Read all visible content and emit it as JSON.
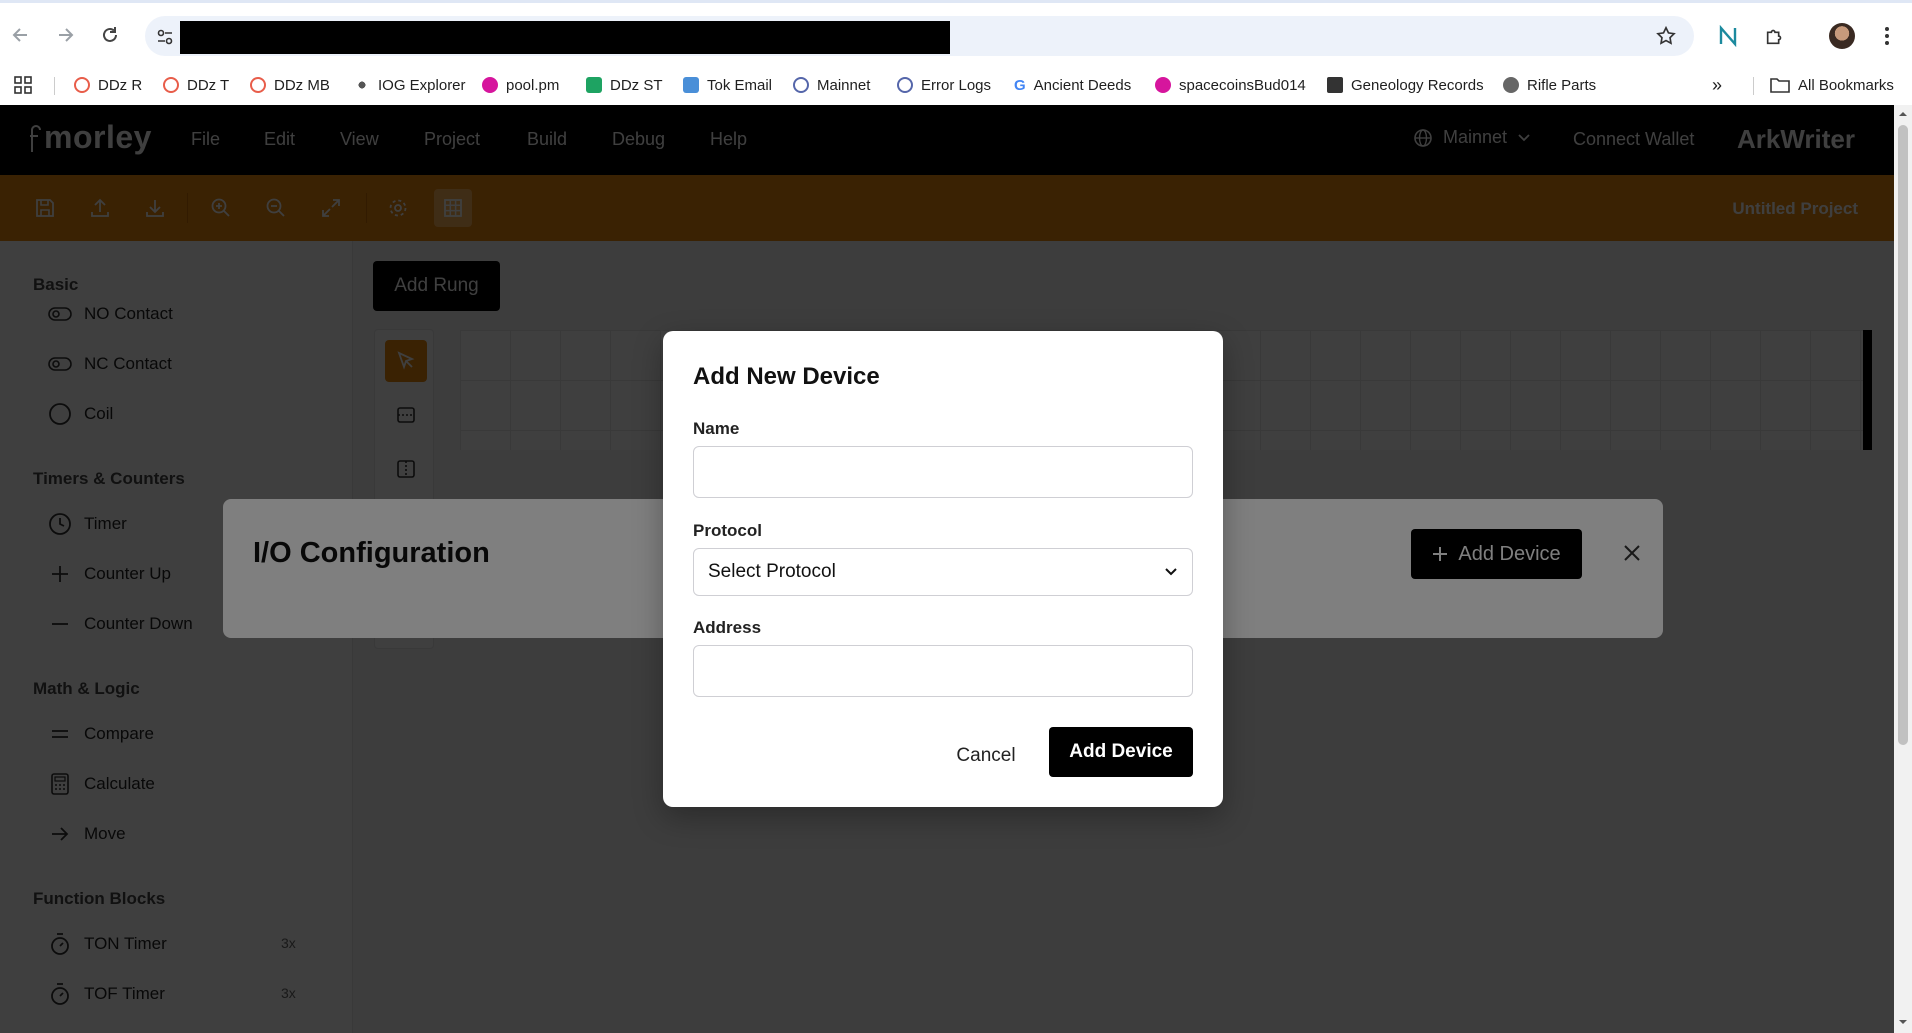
{
  "browser": {
    "bookmarks": [
      {
        "label": "DDz R",
        "color": "#e85d4a"
      },
      {
        "label": "DDz T",
        "color": "#e85d4a"
      },
      {
        "label": "DDz MB",
        "color": "#e85d4a"
      },
      {
        "label": "IOG Explorer",
        "color": "#555555"
      },
      {
        "label": "pool.pm",
        "color": "#d6159d"
      },
      {
        "label": "DDz ST",
        "color": "#1ea362"
      },
      {
        "label": "Tok Email",
        "color": "#4a8fd8"
      },
      {
        "label": "Mainnet",
        "color": "#5566aa"
      },
      {
        "label": "Error Logs",
        "color": "#5566aa"
      },
      {
        "label": "Ancient Deeds",
        "color": "#4285f4"
      },
      {
        "label": "spacecoinsBud014",
        "color": "#d6159d"
      },
      {
        "label": "Geneology Records",
        "color": "#333333"
      },
      {
        "label": "Rifle Parts",
        "color": "#555555"
      }
    ],
    "all_bookmarks": "All Bookmarks"
  },
  "app": {
    "logo": "morley",
    "menu": [
      "File",
      "Edit",
      "View",
      "Project",
      "Build",
      "Debug",
      "Help"
    ],
    "network": "Mainnet",
    "connect_wallet": "Connect Wallet",
    "brand": "ArkWriter",
    "project_title": "Untitled Project",
    "accent": "#e8880e"
  },
  "sidebar": {
    "sections": [
      {
        "title": "Basic",
        "items": [
          {
            "label": "NO Contact",
            "icon": "toggle-icon"
          },
          {
            "label": "NC Contact",
            "icon": "toggle-icon"
          },
          {
            "label": "Coil",
            "icon": "circle-icon"
          }
        ]
      },
      {
        "title": "Timers & Counters",
        "items": [
          {
            "label": "Timer",
            "icon": "clock-icon"
          },
          {
            "label": "Counter Up",
            "icon": "plus-icon"
          },
          {
            "label": "Counter Down",
            "icon": "minus-icon"
          }
        ]
      },
      {
        "title": "Math & Logic",
        "items": [
          {
            "label": "Compare",
            "icon": "equals-icon"
          },
          {
            "label": "Calculate",
            "icon": "calculator-icon"
          },
          {
            "label": "Move",
            "icon": "arrow-right-icon"
          }
        ]
      },
      {
        "title": "Function Blocks",
        "items": [
          {
            "label": "TON Timer",
            "icon": "timer-icon",
            "badge": "3x"
          },
          {
            "label": "TOF Timer",
            "icon": "timer-icon",
            "badge": "3x"
          }
        ]
      }
    ]
  },
  "canvas": {
    "add_rung": "Add Rung"
  },
  "io_panel": {
    "title": "I/O Configuration",
    "add_device": "Add Device"
  },
  "modal": {
    "title": "Add New Device",
    "name_label": "Name",
    "name_value": "",
    "protocol_label": "Protocol",
    "protocol_selected": "Select Protocol",
    "address_label": "Address",
    "address_value": "",
    "cancel": "Cancel",
    "submit": "Add Device"
  }
}
